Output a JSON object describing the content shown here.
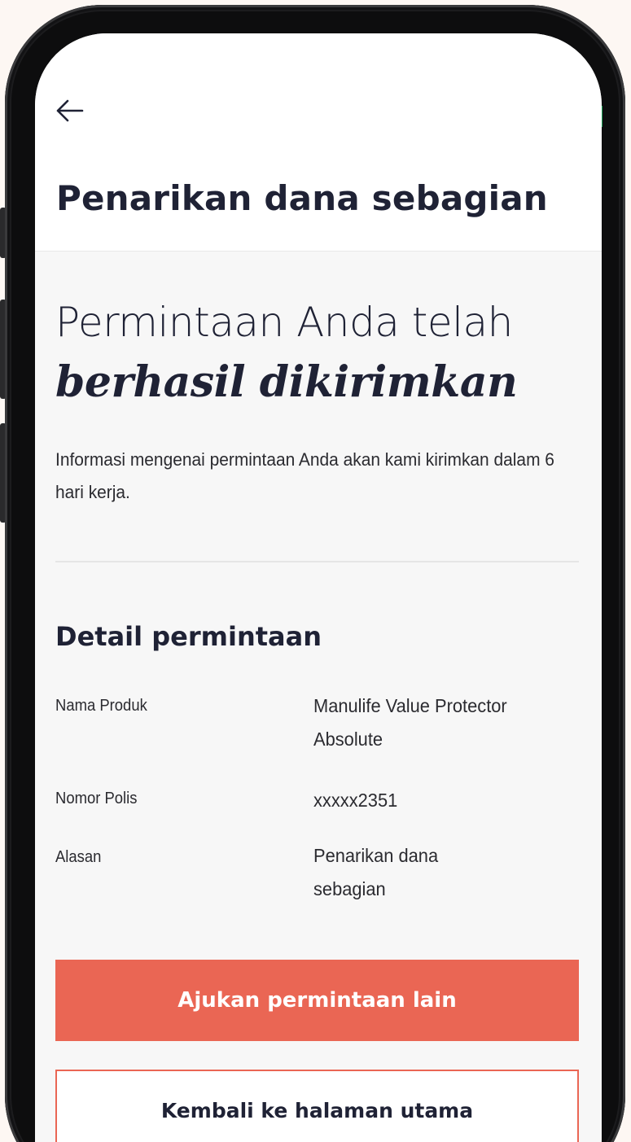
{
  "header": {
    "back_icon": "arrow-left-icon",
    "title": "Penarikan dana sebagian"
  },
  "confirmation": {
    "headline_line1": "Permintaan Anda telah",
    "headline_line2": "berhasil dikirimkan",
    "info": "Informasi mengenai permintaan Anda akan kami kirimkan dalam 6 hari kerja."
  },
  "details": {
    "title": "Detail permintaan",
    "rows": [
      {
        "label": "Nama Produk",
        "value": "Manulife Value Protector Absolute"
      },
      {
        "label": "Nomor Polis",
        "value": "xxxxx2351"
      },
      {
        "label": "Alasan",
        "value": "Penarikan dana sebagian"
      }
    ]
  },
  "actions": {
    "primary_label": "Ajukan permintaan lain",
    "secondary_label": "Kembali ke halaman utama"
  },
  "colors": {
    "accent": "#ea6654",
    "text_dark": "#1f2235",
    "screen_bg": "#f7f7f7",
    "page_bg": "#fdf7f3",
    "frame": "#1c1c1e"
  }
}
